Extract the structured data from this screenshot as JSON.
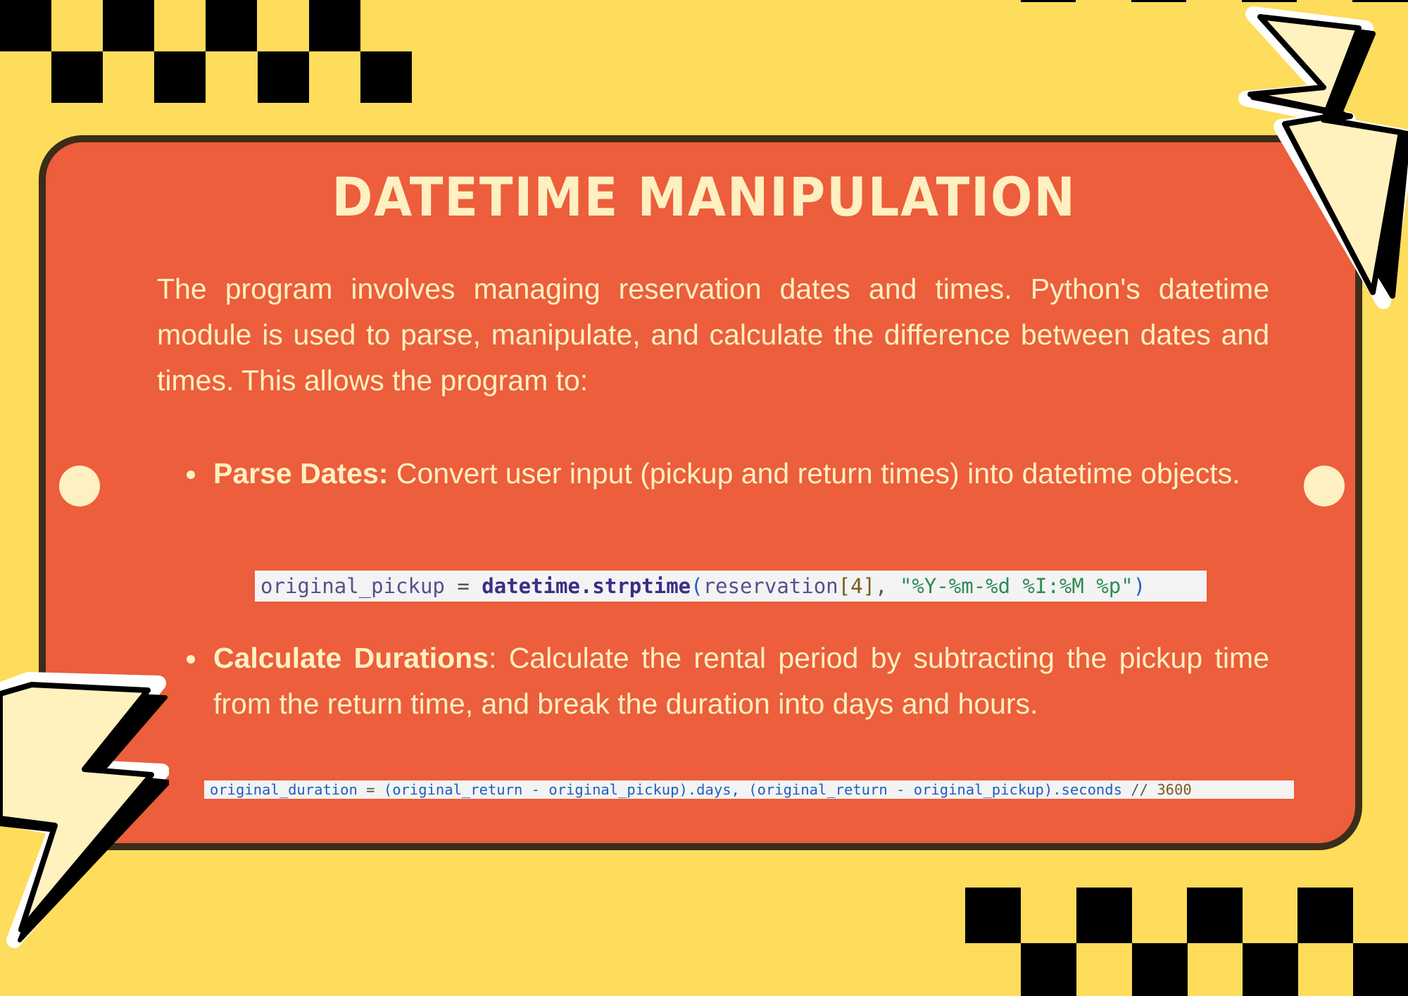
{
  "colors": {
    "background": "#FEDC5C",
    "card": "#EC5E3C",
    "card_border": "#3B2D18",
    "text": "#FEF0C1",
    "checker": "#000000",
    "bolt_fill": "#FFF2BF"
  },
  "title": "DATETIME MANIPULATION",
  "intro": "The program involves managing reservation dates and times. Python's datetime module is used to parse, manipulate, and calculate the difference between dates and times. This allows the program to:",
  "bullets": [
    {
      "term": "Parse Dates:",
      "text": " Convert user input (pickup and return times) into datetime objects.",
      "code": {
        "var": "original_pickup",
        "eq": " = ",
        "fn": "datetime.strptime",
        "open": "(",
        "arg": "reservation",
        "idx": "[4]",
        "comma": ", ",
        "str": "\"%Y-%m-%d %I:%M %p\"",
        "close": ")"
      }
    },
    {
      "term": "Calculate Durations",
      "text": ": Calculate the rental period by subtracting the pickup time from the return time, and break the duration into days and hours.",
      "code": {
        "var": "original_duration",
        "eq": " = ",
        "part1": "(original_return - original_pickup).days, (original_return - original_pickup).seconds",
        "op": " // ",
        "num": "3600"
      }
    }
  ],
  "decorations": {
    "top_left": "checkerboard",
    "bottom_right": "checkerboard",
    "top_right": "lightning-bolt-icon",
    "bottom_left": "lightning-bolt-icon"
  }
}
